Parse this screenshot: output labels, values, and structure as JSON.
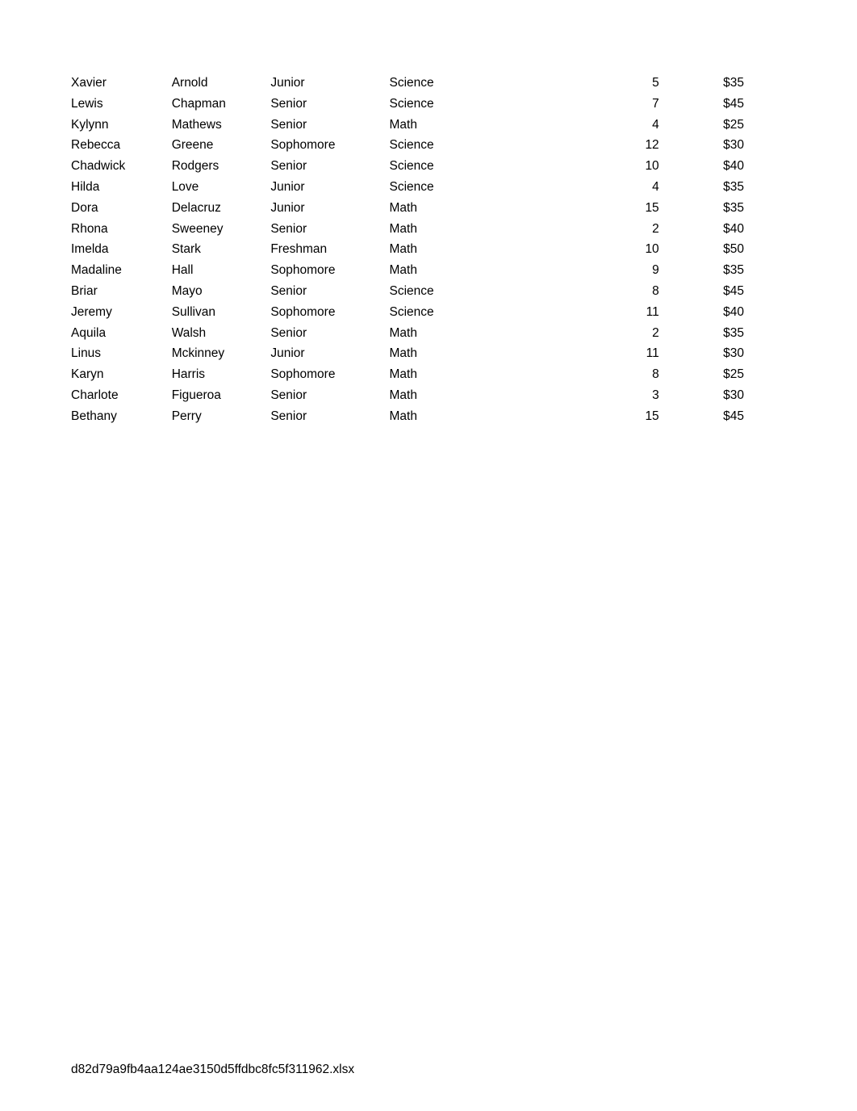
{
  "document": {
    "background_color": "#ffffff",
    "text_color": "#000000",
    "footer_filename": "d82d79a9fb4aa124ae3150d5ffdbc8fc5f311962.xlsx"
  },
  "table": {
    "columns": [
      "first_name",
      "last_name",
      "year",
      "subject",
      "quantity",
      "price"
    ],
    "rows": [
      {
        "first_name": "Xavier",
        "last_name": "Arnold",
        "year": "Junior",
        "subject": "Science",
        "quantity": "5",
        "price": "$35"
      },
      {
        "first_name": "Lewis",
        "last_name": "Chapman",
        "year": "Senior",
        "subject": "Science",
        "quantity": "7",
        "price": "$45"
      },
      {
        "first_name": "Kylynn",
        "last_name": "Mathews",
        "year": "Senior",
        "subject": "Math",
        "quantity": "4",
        "price": "$25"
      },
      {
        "first_name": "Rebecca",
        "last_name": "Greene",
        "year": "Sophomore",
        "subject": "Science",
        "quantity": "12",
        "price": "$30"
      },
      {
        "first_name": "Chadwick",
        "last_name": "Rodgers",
        "year": "Senior",
        "subject": "Science",
        "quantity": "10",
        "price": "$40"
      },
      {
        "first_name": "Hilda",
        "last_name": "Love",
        "year": "Junior",
        "subject": "Science",
        "quantity": "4",
        "price": "$35"
      },
      {
        "first_name": "Dora",
        "last_name": "Delacruz",
        "year": "Junior",
        "subject": "Math",
        "quantity": "15",
        "price": "$35"
      },
      {
        "first_name": "Rhona",
        "last_name": "Sweeney",
        "year": "Senior",
        "subject": "Math",
        "quantity": "2",
        "price": "$40"
      },
      {
        "first_name": "Imelda",
        "last_name": "Stark",
        "year": "Freshman",
        "subject": "Math",
        "quantity": "10",
        "price": "$50"
      },
      {
        "first_name": "Madaline",
        "last_name": "Hall",
        "year": "Sophomore",
        "subject": "Math",
        "quantity": "9",
        "price": "$35"
      },
      {
        "first_name": "Briar",
        "last_name": "Mayo",
        "year": "Senior",
        "subject": "Science",
        "quantity": "8",
        "price": "$45"
      },
      {
        "first_name": "Jeremy",
        "last_name": "Sullivan",
        "year": "Sophomore",
        "subject": "Science",
        "quantity": "11",
        "price": "$40"
      },
      {
        "first_name": "Aquila",
        "last_name": "Walsh",
        "year": "Senior",
        "subject": "Math",
        "quantity": "2",
        "price": "$35"
      },
      {
        "first_name": "Linus",
        "last_name": "Mckinney",
        "year": "Junior",
        "subject": "Math",
        "quantity": "11",
        "price": "$30"
      },
      {
        "first_name": "Karyn",
        "last_name": "Harris",
        "year": "Sophomore",
        "subject": "Math",
        "quantity": "8",
        "price": "$25"
      },
      {
        "first_name": "Charlote",
        "last_name": "Figueroa",
        "year": "Senior",
        "subject": "Math",
        "quantity": "3",
        "price": "$30"
      },
      {
        "first_name": "Bethany",
        "last_name": "Perry",
        "year": "Senior",
        "subject": "Math",
        "quantity": "15",
        "price": "$45"
      }
    ]
  }
}
